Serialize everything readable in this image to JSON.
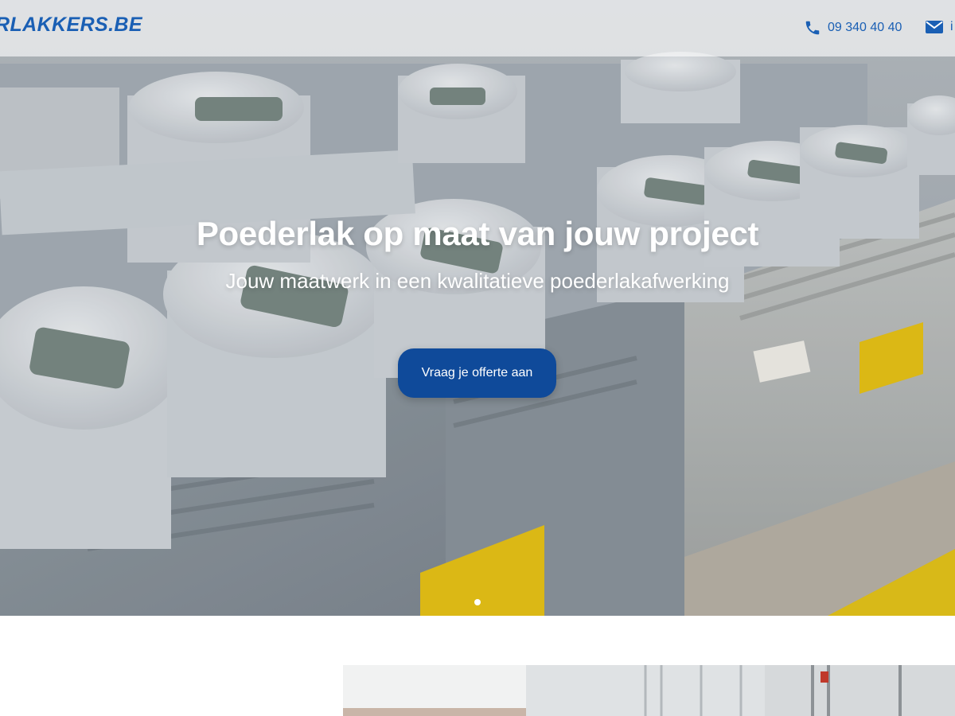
{
  "header": {
    "logo_text": "RLAKKERS.BE",
    "phone": "09 340 40 40",
    "email_visible": "i",
    "phone_icon": "phone-icon",
    "mail_icon": "envelope-icon"
  },
  "hero": {
    "title": "Poederlak op maat van jouw project",
    "subtitle": "Jouw maatwerk in een kwalitatieve poederlakafwerking",
    "cta_label": "Vraag je offerte aan",
    "slide_count": 1,
    "active_slide": 1
  },
  "colors": {
    "brand_blue": "#1a5fb4",
    "cta_blue": "#0f4a9a",
    "hero_text": "#ffffff"
  }
}
